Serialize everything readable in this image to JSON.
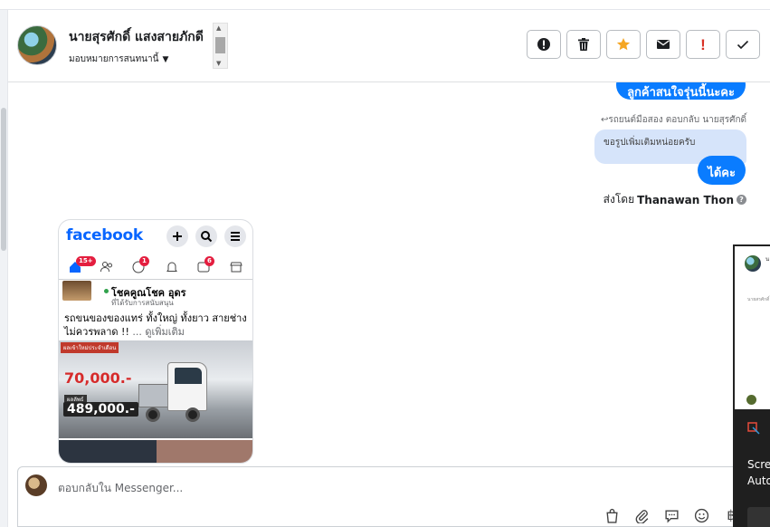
{
  "header": {
    "contact_name": "นายสุรศักดิ์ แสงสายภักดี",
    "assign_label": "มอบหมายการสนทนานี้",
    "actions": [
      {
        "name": "alert-button",
        "icon": "exclamation-circle-icon"
      },
      {
        "name": "delete-button",
        "icon": "trash-icon"
      },
      {
        "name": "star-button",
        "icon": "star-icon",
        "color": "#f5a623"
      },
      {
        "name": "mail-button",
        "icon": "envelope-icon"
      },
      {
        "name": "important-button",
        "icon": "exclamation-icon",
        "color": "#d93025"
      },
      {
        "name": "done-button",
        "icon": "check-icon"
      }
    ]
  },
  "messages": {
    "top_partial": "ลูกค้าสนใจรุ่นนี้นะคะ",
    "reply_note": "รถยนต์มือสอง ตอบกลับ นายสุรศักดิ์",
    "quoted": "ขอรูปเพิ่มเติมหน่อยครับ",
    "reply": "ได้คะ",
    "sent_by_prefix": "ส่งโดย",
    "sent_by_name": "Thanawan Thon"
  },
  "screenshot_post": {
    "app_logo": "facebook",
    "badges": {
      "home": "15+",
      "messenger": "1",
      "video": "6"
    },
    "page_name": "โชคคูณโชค อุดร",
    "page_meta": "ที่ได้รับการสนับสนุน",
    "text": "รถขนของของแทร่ ทั้งใหญ่ ทั้งยาว สายช่างไม่ควรพลาด !!",
    "more": "... ดูเพิ่มเติม",
    "promo": "ผลเข้าใหม่ประจำเดือน",
    "price_main": "70,000.-",
    "price_label": "ผลลัพธ์",
    "price_total": "489,000.-"
  },
  "composer": {
    "placeholder": "ตอบกลับใน Messenger...",
    "tools": [
      "bag-icon",
      "paperclip-icon",
      "speech-bubble-icon",
      "smiley-icon",
      "baht-icon"
    ],
    "baht_symbol": "฿"
  },
  "overlay": {
    "line1": "Scre",
    "line2": "Auto",
    "tiny_name": "น",
    "tiny_text": "นายสรศักดิ์"
  },
  "colors": {
    "messenger_blue": "#0a7cff",
    "quote_bg": "#d6e4fa",
    "facebook_blue": "#0866ff",
    "star": "#f5a623",
    "danger": "#d93025"
  }
}
